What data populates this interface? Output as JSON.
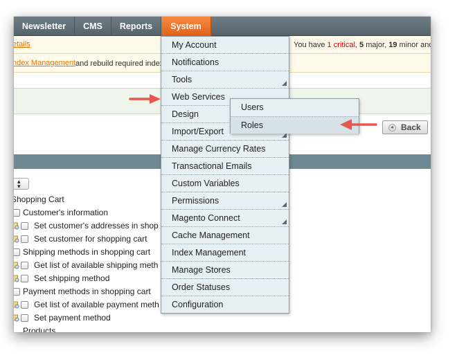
{
  "nav": {
    "items": [
      {
        "label": "Newsletter"
      },
      {
        "label": "CMS"
      },
      {
        "label": "Reports"
      },
      {
        "label": "System"
      }
    ]
  },
  "notices": {
    "details_link": "etails",
    "critical_prefix": "You have",
    "critical_count": "1 critical",
    "major": "5",
    "major_label": "major,",
    "minor": "19",
    "minor_label": "minor and",
    "index_link": "ndex Management",
    "index_text": "and rebuild required index"
  },
  "back_button": {
    "label": "Back"
  },
  "system_menu": {
    "items": [
      {
        "label": "My Account"
      },
      {
        "label": "Notifications"
      },
      {
        "label": "Tools"
      },
      {
        "label": "Web Services"
      },
      {
        "label": "Design"
      },
      {
        "label": "Import/Export"
      },
      {
        "label": "Manage Currency Rates"
      },
      {
        "label": "Transactional Emails"
      },
      {
        "label": "Custom Variables"
      },
      {
        "label": "Permissions"
      },
      {
        "label": "Magento Connect"
      },
      {
        "label": "Cache Management"
      },
      {
        "label": "Index Management"
      },
      {
        "label": "Manage Stores"
      },
      {
        "label": "Order Statuses"
      },
      {
        "label": "Configuration"
      }
    ]
  },
  "webservices_submenu": {
    "items": [
      {
        "label": "Users"
      },
      {
        "label": "Roles"
      }
    ]
  },
  "tree": {
    "rows": [
      {
        "label": "Shopping Cart"
      },
      {
        "label": "Customer's information"
      },
      {
        "label": "Set customer's addresses in shop"
      },
      {
        "label": "Set customer for shopping cart"
      },
      {
        "label": "Shipping methods in shopping cart"
      },
      {
        "label": "Get list of available shipping meth"
      },
      {
        "label": "Set shipping method"
      },
      {
        "label": "Payment methods in shopping cart"
      },
      {
        "label": "Get list of available payment meth"
      },
      {
        "label": "Set payment method"
      },
      {
        "label": "Products"
      }
    ]
  },
  "colors": {
    "nav_bg": "#5f6c74",
    "system_active": "#eb6d24",
    "link": "#ea7601",
    "critical": "#d40707",
    "menu_bg": "#e6eff3",
    "arrow": "#e8574e"
  }
}
